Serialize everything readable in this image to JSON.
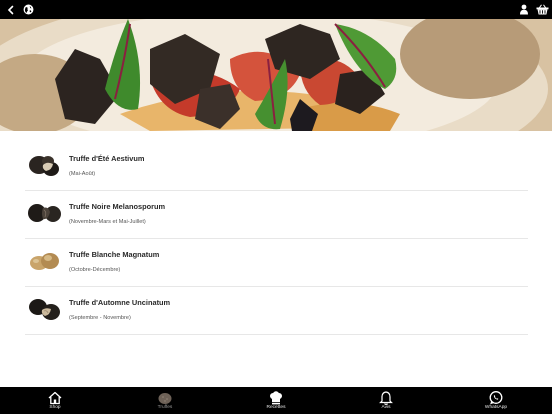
{
  "nav": {
    "back_icon": "chevron-left-icon",
    "globe_icon": "globe-icon",
    "user_icon": "user-icon",
    "cart_icon": "basket-icon"
  },
  "hero": {
    "image": "truffle-dish-photo"
  },
  "truffles": [
    {
      "name": "Truffe d'Été Aestivum",
      "season": "(Mai-Août)",
      "thumb": "black-truffle-thumb"
    },
    {
      "name": "Truffe Noire Melanosporum",
      "season": "(Novembre-Mars et Mai-Juillet)",
      "thumb": "black-truffle-thumb"
    },
    {
      "name": "Truffe Blanche Magnatum",
      "season": "(Octobre-Décembre)",
      "thumb": "white-truffle-thumb"
    },
    {
      "name": "Truffe d'Automne Uncinatum",
      "season": "(Septembre - Novembre)",
      "thumb": "black-truffle-thumb"
    }
  ],
  "tabs": [
    {
      "label": "Shop",
      "icon": "home-icon"
    },
    {
      "label": "Truffes",
      "icon": "truffle-icon",
      "active": true
    },
    {
      "label": "Recettes",
      "icon": "chef-hat-icon"
    },
    {
      "label": "Avis",
      "icon": "bell-icon"
    },
    {
      "label": "WhatsApp",
      "icon": "whatsapp-icon"
    }
  ],
  "colors": {
    "bar": "#000000",
    "divider": "#e7e7e7",
    "active_tab_label": "#9a9a9a"
  }
}
